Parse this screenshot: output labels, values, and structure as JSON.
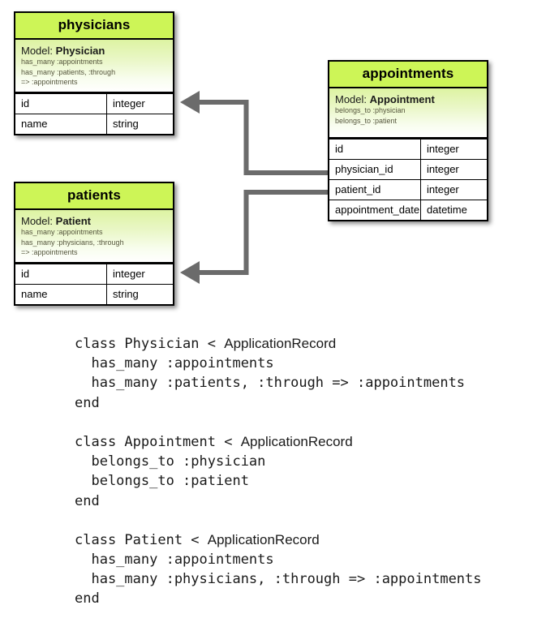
{
  "diagram": {
    "entities": [
      {
        "id": "physicians",
        "title": "physicians",
        "model_label": "Model:",
        "model_name": "Physician",
        "associations": [
          "has_many :appointments",
          "has_many :patients, :through",
          "=> :appointments"
        ],
        "attributes": [
          {
            "name": "id",
            "type": "integer"
          },
          {
            "name": "name",
            "type": "string"
          }
        ]
      },
      {
        "id": "appointments",
        "title": "appointments",
        "model_label": "Model:",
        "model_name": "Appointment",
        "associations": [
          "belongs_to :physician",
          "belongs_to :patient"
        ],
        "attributes": [
          {
            "name": "id",
            "type": "integer"
          },
          {
            "name": "physician_id",
            "type": "integer"
          },
          {
            "name": "patient_id",
            "type": "integer"
          },
          {
            "name": "appointment_date",
            "type": "datetime"
          }
        ]
      },
      {
        "id": "patients",
        "title": "patients",
        "model_label": "Model:",
        "model_name": "Patient",
        "associations": [
          "has_many :appointments",
          "has_many :physicians, :through",
          "=> :appointments"
        ],
        "attributes": [
          {
            "name": "id",
            "type": "integer"
          },
          {
            "name": "name",
            "type": "string"
          }
        ]
      }
    ],
    "relationships": [
      {
        "from": "appointments.physician_id",
        "to": "physicians.id"
      },
      {
        "from": "appointments.patient_id",
        "to": "patients.id"
      }
    ],
    "colors": {
      "header_green": "#cdf557",
      "model_gradient_top": "#ddf3a2",
      "model_gradient_bottom": "#ffffff",
      "border": "#000000",
      "connector_gray": "#6b6b6b",
      "background": "#ffffff",
      "assoc_text": "#56563f"
    }
  },
  "code": {
    "lines": [
      {
        "text": "class Physician < ",
        "tail": "ApplicationRecord"
      },
      {
        "text": "  has_many :appointments",
        "tail": ""
      },
      {
        "text": "  has_many :patients, :through => :appointments",
        "tail": ""
      },
      {
        "text": "end",
        "tail": ""
      },
      {
        "text": "",
        "tail": ""
      },
      {
        "text": "class Appointment < ",
        "tail": "ApplicationRecord"
      },
      {
        "text": "  belongs_to :physician",
        "tail": ""
      },
      {
        "text": "  belongs_to :patient",
        "tail": ""
      },
      {
        "text": "end",
        "tail": ""
      },
      {
        "text": "",
        "tail": ""
      },
      {
        "text": "class Patient < ",
        "tail": "ApplicationRecord"
      },
      {
        "text": "  has_many :appointments",
        "tail": ""
      },
      {
        "text": "  has_many :physicians, :through => :appointments",
        "tail": ""
      },
      {
        "text": "end",
        "tail": ""
      }
    ]
  }
}
